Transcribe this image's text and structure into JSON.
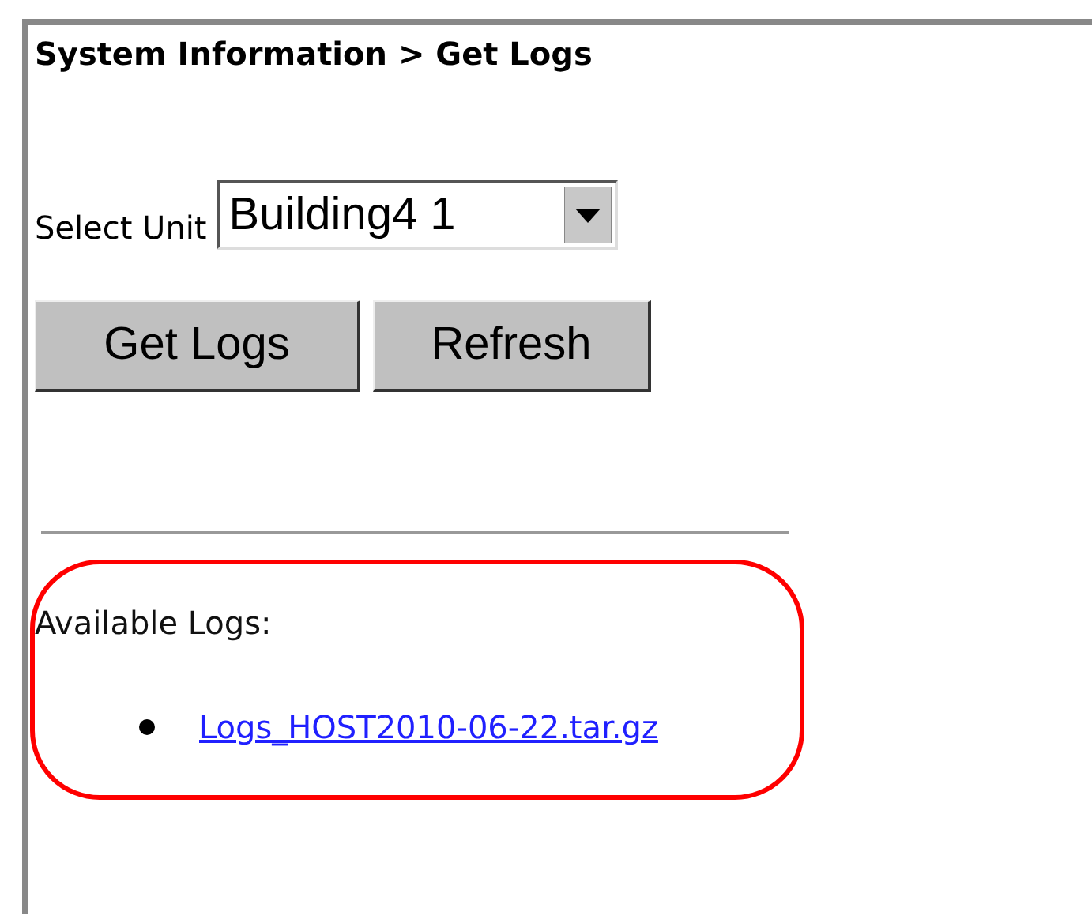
{
  "breadcrumb": "System Information > Get Logs",
  "unit_select": {
    "label": "Select Unit",
    "value": "Building4 1"
  },
  "buttons": [
    "Get Logs",
    "Refresh"
  ],
  "logs": {
    "heading": "Available Logs:",
    "files": [
      "Logs_HOST2010-06-22.tar.gz"
    ]
  }
}
